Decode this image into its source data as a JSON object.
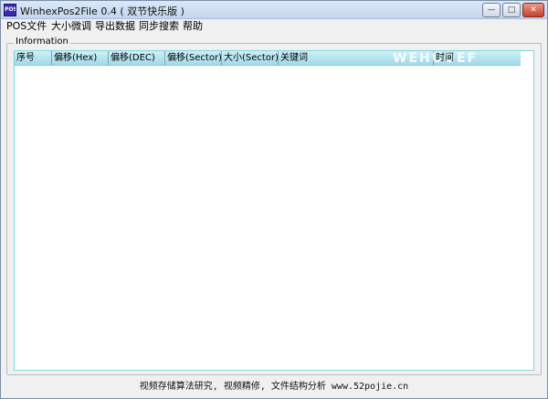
{
  "window": {
    "title": "WinhexPos2File  0.4 ( 双节快乐版 )",
    "icon_text": "POS",
    "minimize_glyph": "—",
    "maximize_glyph": "□",
    "close_glyph": "✕"
  },
  "menu": {
    "items": [
      "POS文件",
      "大小微调",
      "导出数据",
      "同步搜索",
      "帮助"
    ]
  },
  "group": {
    "label": "Information"
  },
  "list": {
    "columns": [
      "序号",
      "偏移(Hex)",
      "偏移(DEC)",
      "偏移(Sector)",
      "大小(Sector)",
      "关键词",
      "时间"
    ],
    "watermark": "WEHUOEF",
    "rows": []
  },
  "footer": {
    "text": "视频存储算法研究, 视频精修, 文件结构分析 www.52pojie.cn"
  }
}
